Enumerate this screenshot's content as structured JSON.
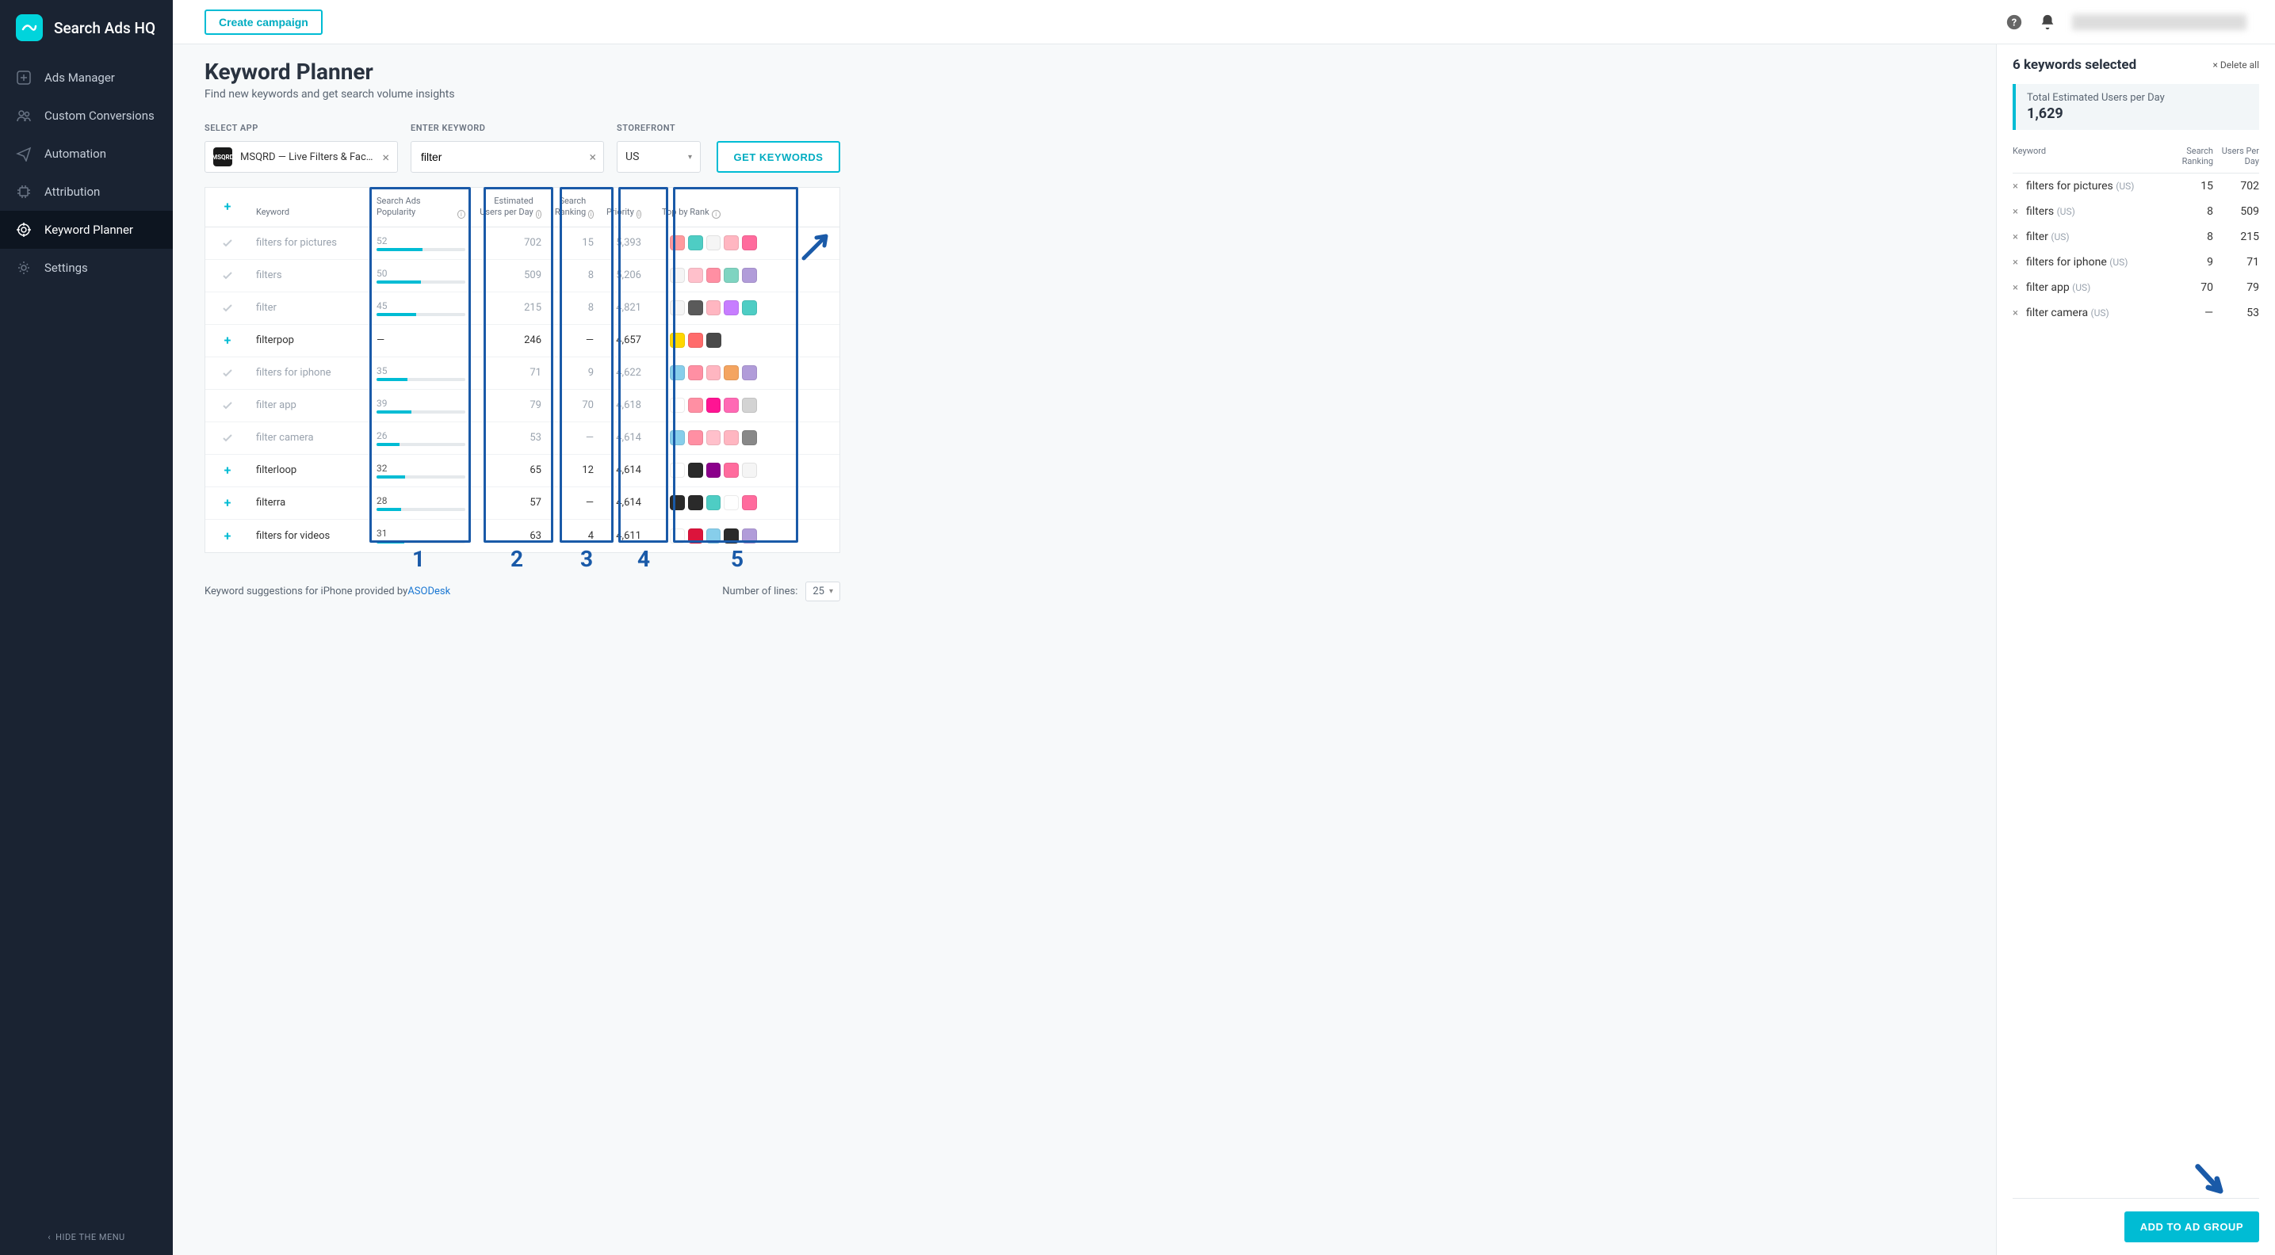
{
  "brand": "Search Ads HQ",
  "nav": {
    "items": [
      {
        "icon": "plus-box",
        "label": "Ads Manager"
      },
      {
        "icon": "users",
        "label": "Custom Conversions"
      },
      {
        "icon": "plane",
        "label": "Automation"
      },
      {
        "icon": "chip",
        "label": "Attribution"
      },
      {
        "icon": "target",
        "label": "Keyword Planner"
      },
      {
        "icon": "gear",
        "label": "Settings"
      }
    ],
    "hide": "HIDE THE MENU"
  },
  "topbar": {
    "create": "Create campaign"
  },
  "page": {
    "title": "Keyword Planner",
    "subtitle": "Find new keywords and get search volume insights"
  },
  "filters": {
    "select_app_label": "SELECT APP",
    "enter_keyword_label": "ENTER KEYWORD",
    "storefront_label": "STOREFRONT",
    "app_name": "MSQRD — Live Filters & Fac…",
    "app_badge": "MSQRD",
    "keyword_value": "filter",
    "storefront_value": "US",
    "get_btn": "GET KEYWORDS"
  },
  "table": {
    "headers": {
      "keyword": "Keyword",
      "popularity": "Search Ads Popularity",
      "users": "Estimated Users per Day",
      "ranking": "Search Ranking",
      "priority": "Priority",
      "top": "Top by Rank"
    },
    "rows": [
      {
        "sel": true,
        "kw": "filters for pictures",
        "pop": "52",
        "users": "702",
        "rank": "15",
        "prio": "5,393",
        "icons": [
          "#ff9a9e",
          "#4ecdc4",
          "#f5f5f5",
          "#ffb6c1",
          "#ff6b9d"
        ]
      },
      {
        "sel": true,
        "kw": "filters",
        "pop": "50",
        "users": "509",
        "rank": "8",
        "prio": "5,206",
        "icons": [
          "#f5f5f5",
          "#ffc0cb",
          "#ff8fa3",
          "#7fd4c1",
          "#b19cd9"
        ]
      },
      {
        "sel": true,
        "kw": "filter",
        "pop": "45",
        "users": "215",
        "rank": "8",
        "prio": "4,821",
        "icons": [
          "#f5f5f5",
          "#5a5a5a",
          "#ffb6c1",
          "#c77dff",
          "#4ecdc4"
        ]
      },
      {
        "sel": false,
        "kw": "filterpop",
        "pop": "—",
        "users": "246",
        "rank": "—",
        "prio": "4,657",
        "nobar": true,
        "icons": [
          "#ffd700",
          "#ff6b6b",
          "#4a4a4a"
        ]
      },
      {
        "sel": true,
        "kw": "filters for iphone",
        "pop": "35",
        "users": "71",
        "rank": "9",
        "prio": "4,622",
        "icons": [
          "#87ceeb",
          "#ff8fa3",
          "#ffb6c1",
          "#f4a460",
          "#b19cd9"
        ]
      },
      {
        "sel": true,
        "kw": "filter app",
        "pop": "39",
        "users": "79",
        "rank": "70",
        "prio": "4,618",
        "icons": [
          "#fff",
          "#ff8fa3",
          "#ff1493",
          "#ff69b4",
          "#d3d3d3"
        ]
      },
      {
        "sel": true,
        "kw": "filter camera",
        "pop": "26",
        "users": "53",
        "rank": "—",
        "prio": "4,614",
        "icons": [
          "#87ceeb",
          "#ff8fa3",
          "#ffc0cb",
          "#ffb6c1",
          "#888"
        ]
      },
      {
        "sel": false,
        "kw": "filterloop",
        "pop": "32",
        "users": "65",
        "rank": "12",
        "prio": "4,614",
        "icons": [
          "#fff",
          "#2a2a2a",
          "#8b008b",
          "#ff6b9d",
          "#f5f5f5"
        ]
      },
      {
        "sel": false,
        "kw": "filterra",
        "pop": "28",
        "users": "57",
        "rank": "—",
        "prio": "4,614",
        "icons": [
          "#2a2a2a",
          "#2a2a2a",
          "#4ecdc4",
          "#fff",
          "#ff6b9d"
        ]
      },
      {
        "sel": false,
        "kw": "filters for videos",
        "pop": "31",
        "users": "63",
        "rank": "4",
        "prio": "4,611",
        "icons": [
          "#fff",
          "#dc143c",
          "#87ceeb",
          "#2a2a2a",
          "#b19cd9"
        ]
      }
    ],
    "annotations": [
      "1",
      "2",
      "3",
      "4",
      "5"
    ]
  },
  "footer": {
    "text": "Keyword suggestions for iPhone provided by ",
    "link": "ASODesk",
    "lines_label": "Number of lines:",
    "lines_value": "25"
  },
  "panel": {
    "title": "6 keywords selected",
    "delete_all": "Delete all",
    "est_label": "Total Estimated Users per Day",
    "est_value": "1,629",
    "headers": {
      "kw": "Keyword",
      "rank": "Search Ranking",
      "users": "Users Per Day"
    },
    "rows": [
      {
        "kw": "filters for pictures",
        "loc": "(US)",
        "rank": "15",
        "users": "702"
      },
      {
        "kw": "filters",
        "loc": "(US)",
        "rank": "8",
        "users": "509"
      },
      {
        "kw": "filter",
        "loc": "(US)",
        "rank": "8",
        "users": "215"
      },
      {
        "kw": "filters for iphone",
        "loc": "(US)",
        "rank": "9",
        "users": "71"
      },
      {
        "kw": "filter app",
        "loc": "(US)",
        "rank": "70",
        "users": "79"
      },
      {
        "kw": "filter camera",
        "loc": "(US)",
        "rank": "—",
        "users": "53"
      }
    ],
    "add_btn": "ADD TO AD GROUP"
  }
}
